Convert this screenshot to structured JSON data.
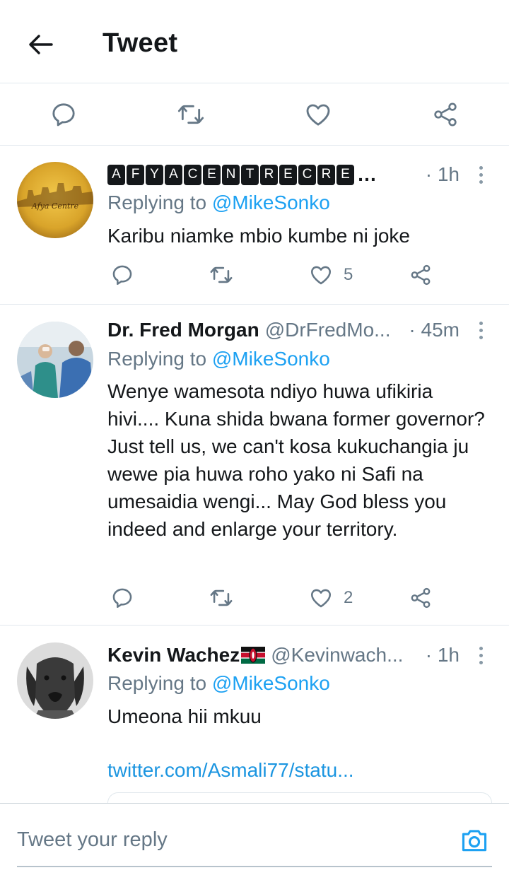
{
  "header": {
    "title": "Tweet"
  },
  "colors": {
    "accent": "#1da1f2",
    "secondary_text": "#657786",
    "divider": "#e1e8ed"
  },
  "action_bar": {
    "icons": [
      "reply-icon",
      "retweet-icon",
      "like-icon",
      "share-icon"
    ]
  },
  "replies": [
    {
      "name": "AFYACENTRECRE",
      "name_letters": [
        "A",
        "F",
        "Y",
        "A",
        "C",
        "E",
        "N",
        "T",
        "R",
        "E",
        "C",
        "R",
        "E"
      ],
      "name_ellipsis": "…",
      "handle": "",
      "time": "· 1h",
      "replying_prefix": "Replying to",
      "replying_to": "@MikeSonko",
      "text": "Karibu niamke mbio kumbe ni joke",
      "likes": "5"
    },
    {
      "name": "Dr. Fred Morgan",
      "handle": "@DrFredMo...",
      "time": "· 45m",
      "replying_prefix": "Replying to",
      "replying_to": "@MikeSonko",
      "text": "Wenye wamesota ndiyo huwa ufikiria hivi.... Kuna shida bwana former governor? Just tell us, we can't kosa kukuchangia ju wewe pia huwa roho yako ni Safi na umesaidia wengi... May God bless you indeed and enlarge your territory.",
      "likes": "2"
    },
    {
      "name": "Kevin Wachez",
      "name_emoji": "kenya-flag-icon",
      "handle": "@Kevinwach...",
      "time": "· 1h",
      "replying_prefix": "Replying to",
      "replying_to": "@MikeSonko",
      "text": "Umeona hii mkuu",
      "link": "twitter.com/Asmali77/statu..."
    }
  ],
  "reply_bar": {
    "placeholder": "Tweet your reply"
  }
}
